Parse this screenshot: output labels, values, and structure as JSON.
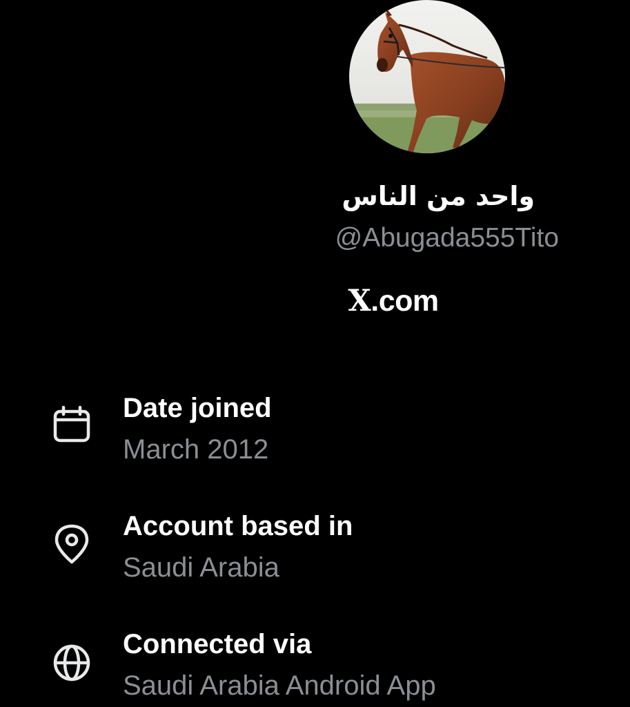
{
  "profile": {
    "display_name": "واحد من الناس",
    "handle": "@Abugada555Tito",
    "site": ".com",
    "site_mark": "X"
  },
  "details": [
    {
      "icon": "calendar-icon",
      "title": "Date joined",
      "value": "March 2012"
    },
    {
      "icon": "location-pin-icon",
      "title": "Account based in",
      "value": "Saudi Arabia"
    },
    {
      "icon": "globe-icon",
      "title": "Connected via",
      "value": "Saudi Arabia Android App"
    }
  ],
  "colors": {
    "background": "#000000",
    "primary_text": "#ffffff",
    "secondary_text": "#8b8f94"
  }
}
